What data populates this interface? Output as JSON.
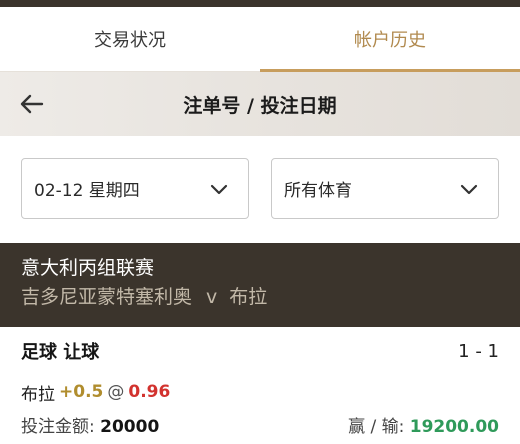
{
  "tabs": [
    {
      "label": "交易状况",
      "active": false
    },
    {
      "label": "帐户历史",
      "active": true
    }
  ],
  "header": {
    "title": "注单号 / 投注日期",
    "back_icon": "arrow-left-icon"
  },
  "filters": {
    "date": "02-12 星期四",
    "sport": "所有体育"
  },
  "league": {
    "name": "意大利丙组联赛",
    "home": "吉多尼亚蒙特塞利奥",
    "vs": "v",
    "away": "布拉"
  },
  "bet": {
    "sport": "足球",
    "market": "让球",
    "score": "1 - 1",
    "selection": "布拉",
    "handicap": "+0.5",
    "at": "@",
    "odds": "0.96",
    "stake_label": "投注金额:",
    "stake": "20000",
    "win_loss_label": "赢 / 输:",
    "win_loss": "19200.00"
  },
  "colors": {
    "accent": "#c79d5d",
    "dark_band": "#3b342c",
    "odds": "#d2322e",
    "handicap": "#b08d2e",
    "win": "#2f9a5a"
  }
}
